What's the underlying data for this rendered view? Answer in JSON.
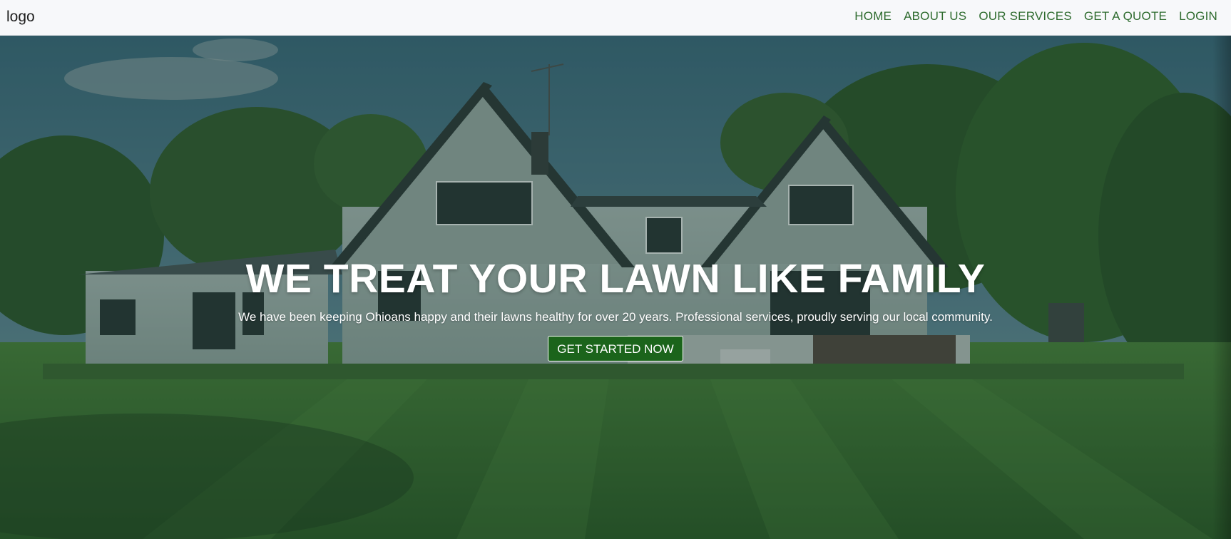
{
  "navbar": {
    "logo": "logo",
    "links": [
      "HOME",
      "ABOUT US",
      "OUR SERVICES",
      "GET A QUOTE",
      "LOGIN"
    ]
  },
  "hero": {
    "title": "WE TREAT YOUR LAWN LIKE FAMILY",
    "subtitle": "We have been keeping Ohioans happy and their lawns healthy for over 20 years. Professional services, proudly serving our local community.",
    "cta_label": "GET STARTED NOW",
    "background_image": "house-with-lawn-photo"
  },
  "colors": {
    "nav_bg": "#f7f8fa",
    "nav_link": "#2e6b2e",
    "cta_bg": "#1b641b",
    "overlay": "#16342c"
  }
}
